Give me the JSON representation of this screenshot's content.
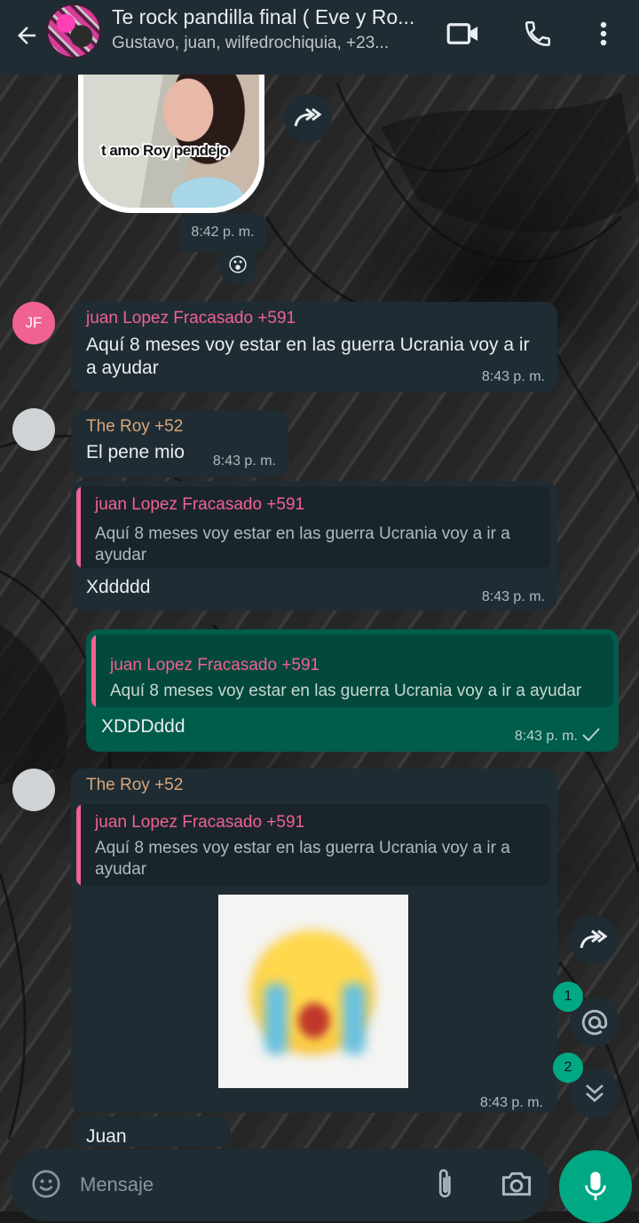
{
  "header": {
    "title": "Te rock pandilla  final ( Eve y Ro...",
    "subtitle": "Gustavo, juan, wilfedrochiquia, +23..."
  },
  "sticker": {
    "caption": "t amo Roy pendejo",
    "time": "8:42 p. m.",
    "reaction": "😮"
  },
  "messages": {
    "m1": {
      "avatar_initials": "JF",
      "sender": "juan Lopez Fracasado +591",
      "text_line1": "Aquí 8 meses voy estar en las guerra Ucrania  voy a ir",
      "text_line2": "a ayudar",
      "time": "8:43 p. m."
    },
    "m2": {
      "sender": "The Roy +52",
      "text": "El pene mio",
      "time": "8:43 p. m."
    },
    "m3": {
      "quote_name": "juan Lopez Fracasado +591",
      "quote_line1": "Aquí 8 meses voy estar en las guerra Ucrania  voy a ir a",
      "quote_line2": "ayudar",
      "text": "Xddddd",
      "time": "8:43 p. m."
    },
    "m4": {
      "quote_name": "juan Lopez Fracasado +591",
      "quote_text": "Aquí 8 meses voy estar en las guerra Ucrania  voy a ir a ayudar",
      "text": "XDDDddd",
      "time": "8:43 p. m."
    },
    "m5": {
      "sender": "The Roy +52",
      "quote_name": "juan Lopez Fracasado +591",
      "quote_line1": "Aquí 8 meses voy estar en las guerra Ucrania  voy a ir a",
      "quote_line2": "ayudar",
      "time": "8:43 p. m."
    },
    "m6": {
      "text": "Juan"
    }
  },
  "badges": {
    "mentions": "1",
    "unread": "2"
  },
  "composer": {
    "placeholder": "Mensaje"
  },
  "colors": {
    "header_bg": "#1f2c33",
    "incoming_bubble": "#1f2c33",
    "outgoing_bubble": "#005c4b",
    "accent_green": "#00a884",
    "sender_pink": "#f06292",
    "sender_tan": "#d9a67b"
  },
  "icons": [
    "back-arrow-icon",
    "video-call-icon",
    "phone-icon",
    "more-vert-icon",
    "forward-icon",
    "at-mention-icon",
    "double-chevron-down-icon",
    "emoji-icon",
    "attach-icon",
    "camera-icon",
    "mic-icon",
    "read-check-icon"
  ]
}
